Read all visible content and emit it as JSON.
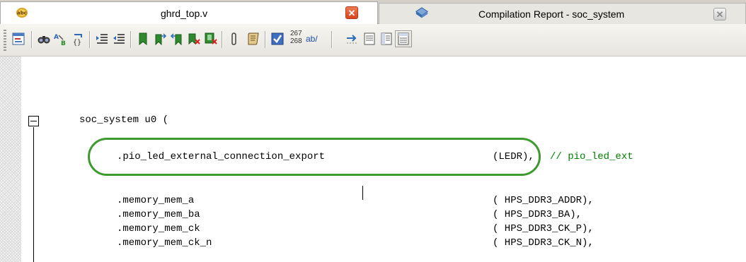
{
  "tabs": [
    {
      "title": "ghrd_top.v",
      "icon": "verilog-file-icon",
      "close_icon": "close-tab-icon",
      "active": true
    },
    {
      "title": "Compilation Report - soc_system",
      "icon": "compilation-report-icon",
      "close_icon": "close-tab-icon",
      "active": false
    }
  ],
  "toolbar": {
    "line_numbers_top": "267",
    "line_numbers_bottom": "268",
    "ab_label": "ab/",
    "buttons": [
      "insert-template-icon",
      "find-icon",
      "find-replace-icon",
      "insert-bracket-icon",
      "increase-indent-icon",
      "decrease-indent-icon",
      "toggle-bookmark-icon",
      "next-bookmark-icon",
      "previous-bookmark-icon",
      "clear-bookmarks-icon",
      "remove-bookmark-icon",
      "attachment-icon",
      "script-icon",
      "check-icon",
      "line-numbers-icon",
      "word-wrap-icon",
      "go-to-line-icon",
      "view-one-icon",
      "view-two-icon",
      "view-three-icon"
    ]
  },
  "editor": {
    "module_line": "soc_system u0 (",
    "highlighted_port": ".pio_led_external_connection_export",
    "highlighted_signal": "(LEDR),",
    "highlighted_comment": "// pio_led_ext",
    "ports": [
      {
        "port": ".memory_mem_a",
        "signal": "( HPS_DDR3_ADDR),"
      },
      {
        "port": ".memory_mem_ba",
        "signal": "( HPS_DDR3_BA),"
      },
      {
        "port": ".memory_mem_ck",
        "signal": "( HPS_DDR3_CK_P),"
      },
      {
        "port": ".memory_mem_ck_n",
        "signal": "( HPS_DDR3_CK_N),"
      }
    ],
    "colors": {
      "highlight_border": "#3d9a2e",
      "comment": "#008000"
    }
  }
}
